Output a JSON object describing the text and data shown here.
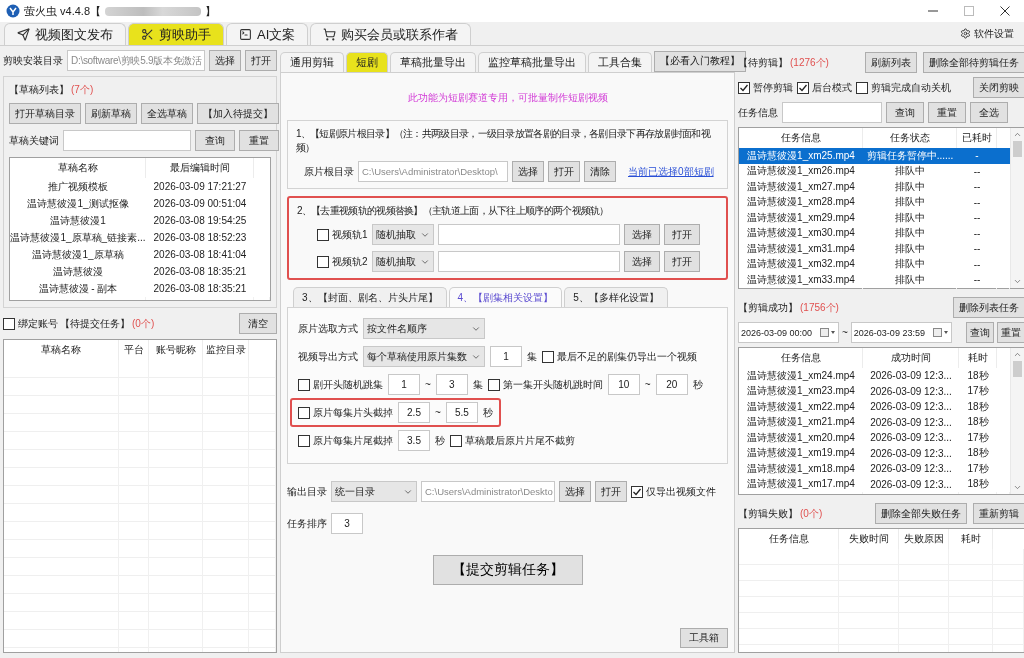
{
  "window": {
    "title": "萤火虫 v4.4.8【",
    "title_end": "】"
  },
  "main_tabs": [
    {
      "label": "视频图文发布",
      "selected": false
    },
    {
      "label": "剪映助手",
      "selected": true
    },
    {
      "label": "AI文案",
      "selected": false
    },
    {
      "label": "购买会员或联系作者",
      "selected": false
    }
  ],
  "settings": "软件设置",
  "left": {
    "install": {
      "label": "剪映安装目录",
      "value": "D:\\software\\剪映5.9版本免激活",
      "buttons": [
        "选择",
        "打开"
      ]
    },
    "drafts": {
      "title": "【草稿列表】",
      "count": "(7个)",
      "buttons": [
        "打开草稿目录",
        "刷新草稿",
        "全选草稿",
        "【加入待提交】"
      ],
      "keyword_label": "草稿关键词",
      "keyword_buttons": [
        "查询",
        "重置"
      ],
      "columns": [
        "草稿名称",
        "最后编辑时间"
      ],
      "rows": [
        {
          "cells": [
            "推广视频模板",
            "2026-03-09 17:21:27"
          ]
        },
        {
          "cells": [
            "温诗慧彼漫1_测试抠像",
            "2026-03-09 00:51:04"
          ]
        },
        {
          "cells": [
            "温诗慧彼漫1",
            "2026-03-08 19:54:25"
          ]
        },
        {
          "cells": [
            "温诗慧彼漫1_原草稿_链接素...",
            "2026-03-08 18:52:23"
          ]
        },
        {
          "cells": [
            "温诗慧彼漫1_原草稿",
            "2026-03-08 18:41:04"
          ]
        },
        {
          "cells": [
            "温诗慧彼漫",
            "2026-03-08 18:35:21"
          ]
        },
        {
          "cells": [
            "温诗慧彼漫 - 副本",
            "2026-03-08 18:35:21"
          ]
        }
      ]
    },
    "pending": {
      "bind": {
        "label": "绑定账号",
        "checked": false
      },
      "title": "【待提交任务】",
      "count": "(0个)",
      "clear": "清空",
      "columns": [
        "草稿名称",
        "平台",
        "账号昵称",
        "监控目录"
      ]
    }
  },
  "center": {
    "tabs": [
      {
        "label": "通用剪辑",
        "selected": false
      },
      {
        "label": "短剧",
        "selected": true
      },
      {
        "label": "草稿批量导出",
        "selected": false
      },
      {
        "label": "监控草稿批量导出",
        "selected": false
      },
      {
        "label": "工具合集",
        "selected": false
      }
    ],
    "tutorial": "【必看入门教程】",
    "notice": "此功能为短剧赛道专用，可批量制作短剧视频",
    "group1": {
      "legend": "1、【短剧原片根目录】（注：共两级目录，一级目录放置各剧的目录，各剧目录下再存放剧封面和视频）",
      "label": "原片根目录",
      "value": "C:\\Users\\Administrator\\Desktop\\",
      "buttons": [
        "选择",
        "打开",
        "清除"
      ],
      "link": "当前已选择0部短剧"
    },
    "group2": {
      "legend": "2、【去重视频轨的视频替换】（主轨道上面，从下往上顺序的两个视频轨）",
      "tracks": [
        {
          "label": "视频轨1",
          "checked": false,
          "mode": "随机抽取",
          "buttons": [
            "选择",
            "打开"
          ]
        },
        {
          "label": "视频轨2",
          "checked": false,
          "mode": "随机抽取",
          "buttons": [
            "选择",
            "打开"
          ]
        }
      ]
    },
    "sub_tabs": [
      {
        "label": "3、【封面、剧名、片头片尾】",
        "selected": false
      },
      {
        "label": "4、【剧集相关设置】",
        "selected": true
      },
      {
        "label": "5、【多样化设置】",
        "selected": false
      }
    ],
    "rows": [
      {
        "highlighted": false,
        "items": [
          {
            "kind": "label",
            "text": "原片选取方式"
          },
          {
            "kind": "select",
            "value": "按文件名顺序"
          }
        ]
      },
      {
        "highlighted": false,
        "items": [
          {
            "kind": "label",
            "text": "视频导出方式"
          },
          {
            "kind": "select",
            "value": "每个草稿使用原片集数"
          },
          {
            "kind": "input",
            "value": "1"
          },
          {
            "kind": "label",
            "text": "集"
          },
          {
            "kind": "check",
            "label": "最后不足的剧集仍导出一个视频",
            "checked": false
          }
        ]
      },
      {
        "highlighted": false,
        "items": [
          {
            "kind": "check",
            "label": "剧开头随机跳集",
            "checked": false
          },
          {
            "kind": "input",
            "value": "1"
          },
          {
            "kind": "label",
            "text": "~"
          },
          {
            "kind": "input",
            "value": "3"
          },
          {
            "kind": "label",
            "text": "集"
          },
          {
            "kind": "check",
            "label": "第一集开头随机跳时间",
            "checked": false
          },
          {
            "kind": "input",
            "value": "10"
          },
          {
            "kind": "label",
            "text": "~"
          },
          {
            "kind": "input",
            "value": "20"
          },
          {
            "kind": "label",
            "text": "秒"
          }
        ]
      },
      {
        "highlighted": true,
        "items": [
          {
            "kind": "check",
            "label": "原片每集片头截掉",
            "checked": false
          },
          {
            "kind": "input",
            "value": "2.5"
          },
          {
            "kind": "label",
            "text": "~"
          },
          {
            "kind": "input",
            "value": "5.5"
          },
          {
            "kind": "label",
            "text": "秒"
          }
        ]
      },
      {
        "highlighted": false,
        "items": [
          {
            "kind": "check",
            "label": "原片每集片尾截掉",
            "checked": false
          },
          {
            "kind": "input",
            "value": "3.5"
          },
          {
            "kind": "label",
            "text": "秒"
          },
          {
            "kind": "check",
            "label": "草稿最后原片片尾不截剪",
            "checked": false
          }
        ]
      }
    ],
    "output": [
      {
        "kind": "label",
        "text": "输出目录"
      },
      {
        "kind": "select",
        "value": "统一目录"
      },
      {
        "kind": "path",
        "value": "C:\\Users\\Administrator\\Deskto"
      },
      {
        "kind": "button",
        "label": "选择"
      },
      {
        "kind": "button",
        "label": "打开"
      },
      {
        "kind": "check",
        "label": "仅导出视频文件",
        "checked": true
      }
    ],
    "order": [
      {
        "kind": "label",
        "text": "任务排序"
      },
      {
        "kind": "input",
        "value": "3"
      }
    ],
    "submit": "【提交剪辑任务】",
    "toolbox": "工具箱"
  },
  "right": {
    "queue": {
      "title": "【待剪辑】",
      "count": "(1276个)",
      "buttons": [
        "刷新列表",
        "删除全部待剪辑任务"
      ],
      "options": [
        {
          "label": "暂停剪辑",
          "checked": true
        },
        {
          "label": "后台模式",
          "checked": true
        },
        {
          "label": "剪辑完成自动关机",
          "checked": false
        }
      ],
      "close": "关闭剪映",
      "search_label": "任务信息",
      "search_buttons": [
        "查询",
        "重置",
        "全选"
      ],
      "columns": [
        "任务信息",
        "任务状态",
        "已耗时"
      ],
      "rows": [
        {
          "cells": [
            "温诗慧彼漫1_xm25.mp4",
            "剪辑任务暂停中......",
            "-"
          ],
          "selected": true
        },
        {
          "cells": [
            "温诗慧彼漫1_xm26.mp4",
            "排队中",
            "--"
          ],
          "selected": false
        },
        {
          "cells": [
            "温诗慧彼漫1_xm27.mp4",
            "排队中",
            "--"
          ],
          "selected": false
        },
        {
          "cells": [
            "温诗慧彼漫1_xm28.mp4",
            "排队中",
            "--"
          ],
          "selected": false
        },
        {
          "cells": [
            "温诗慧彼漫1_xm29.mp4",
            "排队中",
            "--"
          ],
          "selected": false
        },
        {
          "cells": [
            "温诗慧彼漫1_xm30.mp4",
            "排队中",
            "--"
          ],
          "selected": false
        },
        {
          "cells": [
            "温诗慧彼漫1_xm31.mp4",
            "排队中",
            "--"
          ],
          "selected": false
        },
        {
          "cells": [
            "温诗慧彼漫1_xm32.mp4",
            "排队中",
            "--"
          ],
          "selected": false
        },
        {
          "cells": [
            "温诗慧彼漫1_xm33.mp4",
            "排队中",
            "--"
          ],
          "selected": false
        }
      ]
    },
    "success": {
      "title": "【剪辑成功】",
      "count": "(1756个)",
      "button": "删除列表任务",
      "from": "2026-03-09 00:00",
      "sep": "~",
      "to": "2026-03-09 23:59",
      "buttons": [
        "查询",
        "重置"
      ],
      "columns": [
        "任务信息",
        "成功时间",
        "耗时"
      ],
      "rows": [
        {
          "cells": [
            "温诗慧彼漫1_xm24.mp4",
            "2026-03-09 12:3...",
            "18秒"
          ]
        },
        {
          "cells": [
            "温诗慧彼漫1_xm23.mp4",
            "2026-03-09 12:3...",
            "17秒"
          ]
        },
        {
          "cells": [
            "温诗慧彼漫1_xm22.mp4",
            "2026-03-09 12:3...",
            "18秒"
          ]
        },
        {
          "cells": [
            "温诗慧彼漫1_xm21.mp4",
            "2026-03-09 12:3...",
            "18秒"
          ]
        },
        {
          "cells": [
            "温诗慧彼漫1_xm20.mp4",
            "2026-03-09 12:3...",
            "17秒"
          ]
        },
        {
          "cells": [
            "温诗慧彼漫1_xm19.mp4",
            "2026-03-09 12:3...",
            "18秒"
          ]
        },
        {
          "cells": [
            "温诗慧彼漫1_xm18.mp4",
            "2026-03-09 12:3...",
            "17秒"
          ]
        },
        {
          "cells": [
            "温诗慧彼漫1_xm17.mp4",
            "2026-03-09 12:3...",
            "18秒"
          ]
        }
      ]
    },
    "failed": {
      "title": "【剪辑失败】",
      "count": "(0个)",
      "buttons": [
        "删除全部失败任务",
        "重新剪辑"
      ],
      "columns": [
        "任务信息",
        "失败时间",
        "失败原因",
        "耗时"
      ]
    }
  }
}
